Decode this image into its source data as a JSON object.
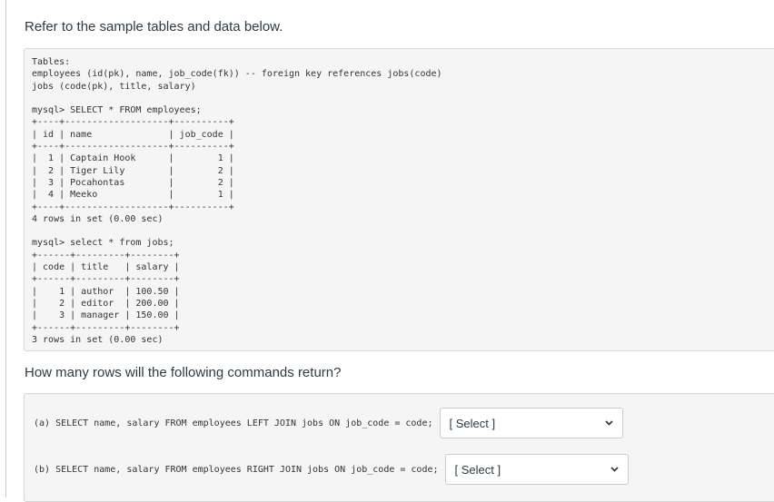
{
  "intro": "Refer to the sample tables and data below.",
  "code_lines": [
    "Tables:",
    "employees (id(pk), name, job_code(fk)) -- foreign key references jobs(code)",
    "jobs (code(pk), title, salary)",
    "",
    "mysql> SELECT * FROM employees;",
    "+----+-------------------+----------+",
    "| id | name              | job_code |",
    "+----+-------------------+----------+",
    "|  1 | Captain Hook      |        1 |",
    "|  2 | Tiger Lily        |        2 |",
    "|  3 | Pocahontas        |        2 |",
    "|  4 | Meeko             |        1 |",
    "+----+-------------------+----------+",
    "4 rows in set (0.00 sec)",
    "",
    "mysql> select * from jobs;",
    "+------+---------+--------+",
    "| code | title   | salary |",
    "+------+---------+--------+",
    "|    1 | author  | 100.50 |",
    "|    2 | editor  | 200.00 |",
    "|    3 | manager | 150.00 |",
    "+------+---------+--------+",
    "3 rows in set (0.00 sec)"
  ],
  "question": "How many rows will the following commands return?",
  "answers": [
    {
      "text": "(a) SELECT name, salary FROM employees LEFT JOIN jobs ON job_code = code;",
      "select_value": "[ Select ]"
    },
    {
      "text": "(b) SELECT name, salary FROM employees RIGHT JOIN jobs ON job_code = code;",
      "select_value": "[ Select ]"
    }
  ],
  "icons": {
    "dropdown": "chevron-down-icon"
  }
}
